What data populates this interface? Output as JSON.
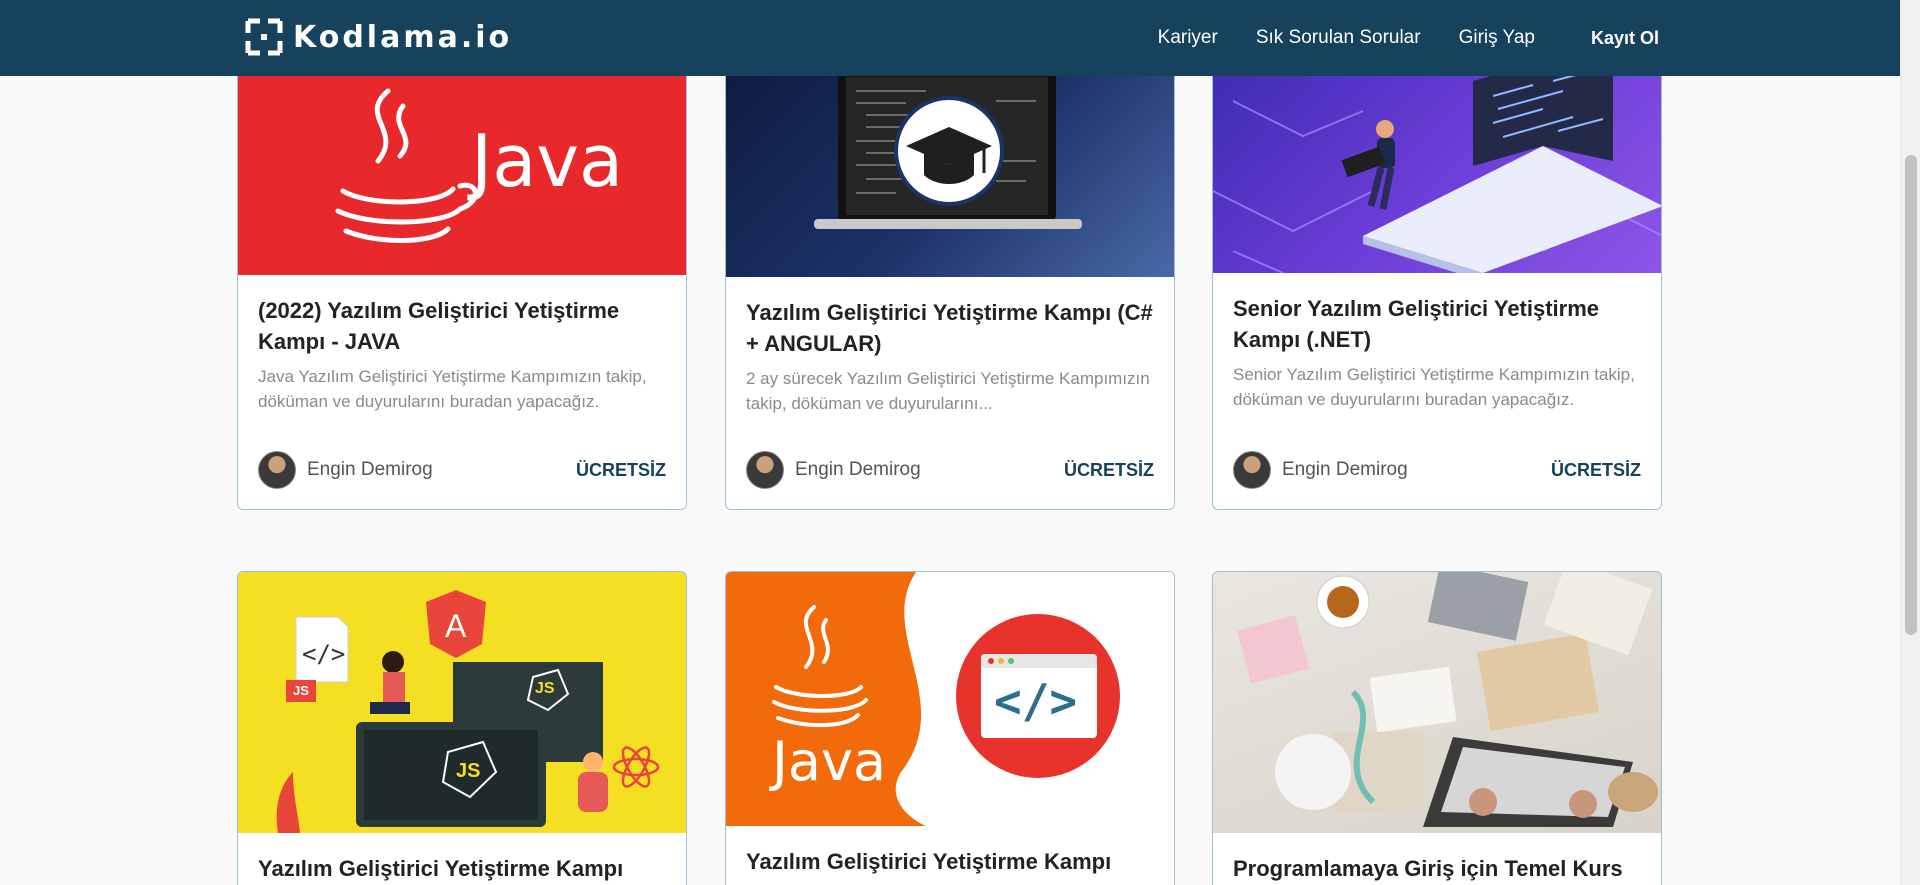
{
  "header": {
    "logo_text": "Kodlama.io",
    "nav": [
      {
        "label": "Kariyer"
      },
      {
        "label": "Sık Sorulan Sorular"
      },
      {
        "label": "Giriş Yap"
      },
      {
        "label": "Kayıt Ol"
      }
    ]
  },
  "cards": [
    {
      "title": "(2022) Yazılım Geliştirici Yetiştirme Kampı - JAVA",
      "description": "Java Yazılım Geliştirici Yetiştirme Kampımızın takip, döküman ve duyurularını buradan yapacağız.",
      "image_text": "Java",
      "author": "Engin Demirog",
      "price": "ÜCRETSİZ"
    },
    {
      "title": "Yazılım Geliştirici Yetiştirme Kampı (C# + ANGULAR)",
      "description": "2 ay sürecek Yazılım Geliştirici Yetiştirme Kampımızın takip, döküman ve duyurularını...",
      "author": "Engin Demirog",
      "price": "ÜCRETSİZ"
    },
    {
      "title": "Senior Yazılım Geliştirici Yetiştirme Kampı (.NET)",
      "description": "Senior Yazılım Geliştirici Yetiştirme Kampımızın takip, döküman ve duyurularını buradan yapacağız.",
      "author": "Engin Demirog",
      "price": "ÜCRETSİZ"
    },
    {
      "title": "Yazılım Geliştirici Yetiştirme Kampı",
      "image_labels": [
        "</>",
        "JS",
        "A",
        "JS",
        "JS"
      ]
    },
    {
      "title": "Yazılım Geliştirici Yetiştirme Kampı",
      "image_text": "Java",
      "image_code": "</>"
    },
    {
      "title": "Programlamaya Giriş için Temel Kurs"
    }
  ],
  "colors": {
    "header_bg": "#16425e",
    "java_red": "#e8282b",
    "price": "#16425e"
  }
}
